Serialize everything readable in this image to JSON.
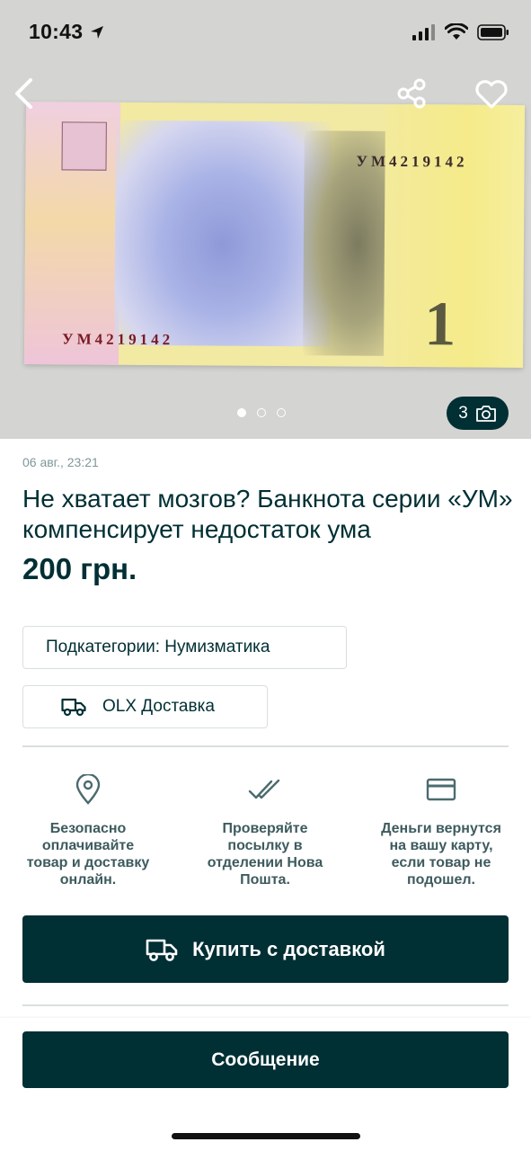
{
  "status_bar": {
    "time": "10:43"
  },
  "gallery": {
    "serial_top": "УМ4219142",
    "serial_bottom": "УМ4219142",
    "denomination": "1",
    "photo_count": "3",
    "dots_total": 3,
    "dot_active_index": 0
  },
  "ad": {
    "posted": "06 авг., 23:21",
    "title": "Не хватает мозгов? Банкнота серии «УМ» компенсирует недостаток ума",
    "price": "200 грн."
  },
  "chips": {
    "subcategory": "Подкатегории: Нумизматика",
    "delivery": "OLX Доставка"
  },
  "features": [
    {
      "icon": "location-pin-icon",
      "text": "Безопасно оплачивайте товар и доставку онлайн."
    },
    {
      "icon": "double-check-icon",
      "text": "Проверяйте посылку в отделении Нова Пошта."
    },
    {
      "icon": "credit-card-icon",
      "text": "Деньги вернутся на вашу карту, если товар не подошел."
    }
  ],
  "actions": {
    "buy_label": "Купить с доставкой",
    "message_label": "Сообщение"
  },
  "colors": {
    "brand_dark": "#002f34",
    "muted_text": "#7f9799",
    "border": "#d8dfe0"
  }
}
